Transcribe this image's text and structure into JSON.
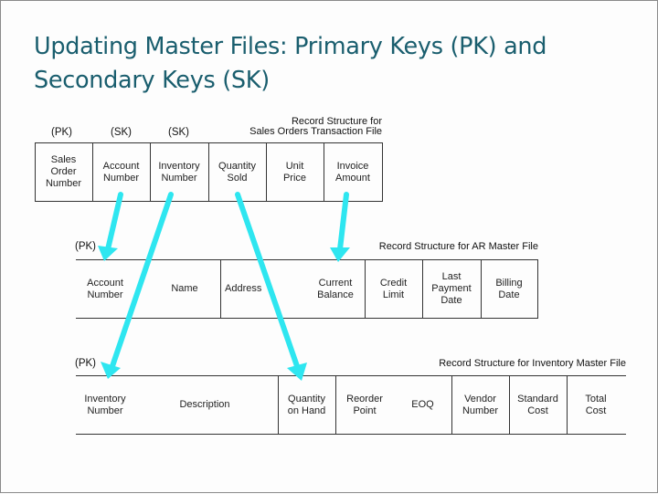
{
  "slide": {
    "title": "Updating Master Files: Primary Keys (PK) and Secondary Keys (SK)",
    "title_line1": "Updating Master Files: Primary Keys (PK) and",
    "title_line2": "Secondary Keys (SK)"
  },
  "colors": {
    "title": "#1a5e6e",
    "arrow": "#2ee6f0",
    "rule": "#333333"
  },
  "tables": [
    {
      "id": "sales-orders-transaction",
      "caption_line1": "Record Structure for",
      "caption_line2": "Sales Orders Transaction File",
      "key_labels": [
        "(PK)",
        "(SK)",
        "(SK)"
      ],
      "fields": [
        {
          "line1": "Sales",
          "line2": "Order",
          "line3": "Number"
        },
        {
          "line1": "Account",
          "line2": "Number"
        },
        {
          "line1": "Inventory",
          "line2": "Number"
        },
        {
          "line1": "Quantity",
          "line2": "Sold"
        },
        {
          "line1": "Unit",
          "line2": "Price"
        },
        {
          "line1": "Invoice",
          "line2": "Amount"
        }
      ]
    },
    {
      "id": "ar-master",
      "caption": "Record Structure for AR Master File",
      "key_labels": [
        "(PK)"
      ],
      "fields": [
        {
          "line1": "Account",
          "line2": "Number"
        },
        {
          "line1": "Name"
        },
        {
          "line1": "Address"
        },
        {
          "line1": "Current",
          "line2": "Balance"
        },
        {
          "line1": "Credit",
          "line2": "Limit"
        },
        {
          "line1": "Last",
          "line2": "Payment",
          "line3": "Date"
        },
        {
          "line1": "Billing",
          "line2": "Date"
        }
      ]
    },
    {
      "id": "inventory-master",
      "caption": "Record Structure for Inventory Master File",
      "key_labels": [
        "(PK)"
      ],
      "fields": [
        {
          "line1": "Inventory",
          "line2": "Number"
        },
        {
          "line1": "Description"
        },
        {
          "line1": "Quantity",
          "line2": "on Hand"
        },
        {
          "line1": "Reorder",
          "line2": "Point"
        },
        {
          "line1": "EOQ"
        },
        {
          "line1": "Vendor",
          "line2": "Number"
        },
        {
          "line1": "Standard",
          "line2": "Cost"
        },
        {
          "line1": "Total",
          "line2": "Cost"
        }
      ]
    }
  ],
  "links": [
    {
      "from": "Sales Orders: Account Number",
      "to": "AR Master: Account Number"
    },
    {
      "from": "Sales Orders: Inventory Number",
      "to": "Inventory Master: Inventory Number"
    },
    {
      "from": "Sales Orders: Quantity Sold",
      "to": "Inventory Master: Quantity on Hand"
    },
    {
      "from": "Sales Orders: Invoice Amount",
      "to": "AR Master: Current Balance"
    }
  ]
}
